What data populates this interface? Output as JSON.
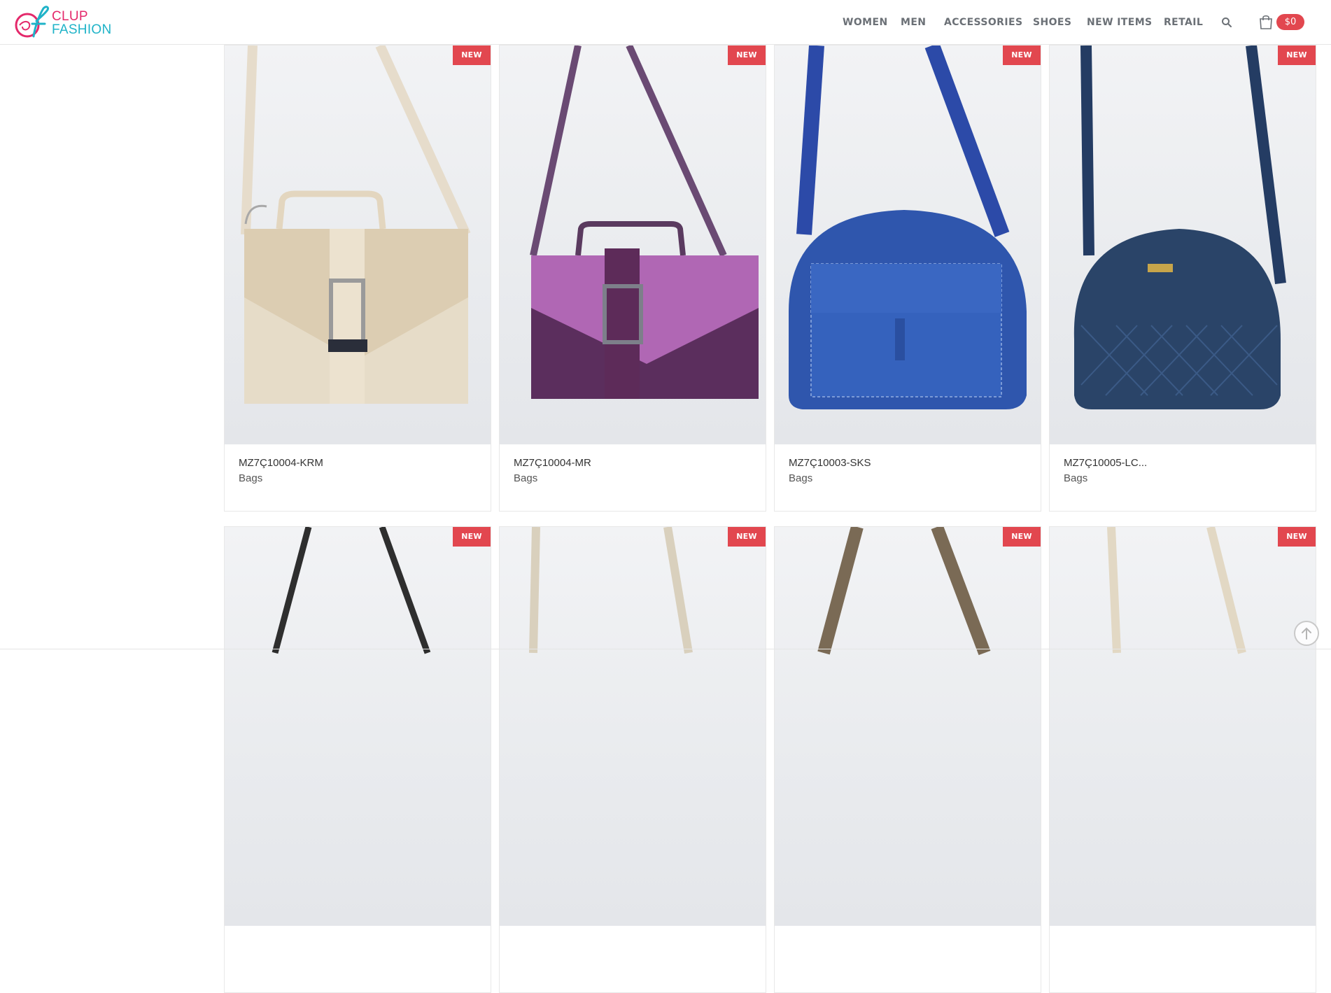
{
  "brand": {
    "line1": "CLUP",
    "line2": "FASHION",
    "pink": "#e4296b",
    "teal": "#1fb3c8"
  },
  "nav": {
    "items": [
      "WOMEN",
      "MEN",
      "ACCESSORIES",
      "SHOES",
      "NEW ITEMS",
      "RETAIL"
    ],
    "search_icon": "search-icon",
    "cart_icon": "shopping-bag-icon",
    "cart_total": "$0"
  },
  "accent_color": "#e2474f",
  "products_row1": [
    {
      "badge": "NEW",
      "title": "MZ7Ç10004-KRM",
      "category": "Bags",
      "bag_color": "#e3d6bf"
    },
    {
      "badge": "NEW",
      "title": "MZ7Ç10004-MR",
      "category": "Bags",
      "bag_color": "#a262a6"
    },
    {
      "badge": "NEW",
      "title": "MZ7Ç10003-SKS",
      "category": "Bags",
      "bag_color": "#2f56ad"
    },
    {
      "badge": "NEW",
      "title": "MZ7Ç10005-LC...",
      "category": "Bags",
      "bag_color": "#2a4468"
    }
  ],
  "products_row2": [
    {
      "badge": "NEW",
      "strap_color": "#2e2e2e"
    },
    {
      "badge": "NEW",
      "strap_color": "#d9d0bd"
    },
    {
      "badge": "NEW",
      "strap_color": "#7a6a55"
    },
    {
      "badge": "NEW",
      "strap_color": "#e2d8c4"
    }
  ]
}
